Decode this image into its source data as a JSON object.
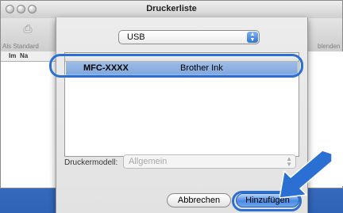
{
  "window": {
    "title": "Druckerliste"
  },
  "toolbar": {
    "left_label": "Als Standard",
    "right_label": "blenden"
  },
  "list_columns": [
    "Im",
    "Na"
  ],
  "sheet": {
    "connection_popup": {
      "selected": "USB"
    },
    "printer_list": {
      "rows": [
        {
          "name": "MFC-XXXX",
          "kind": "Brother Ink",
          "selected": true
        }
      ]
    },
    "model": {
      "label": "Druckermodell:",
      "value": "Allgemein",
      "enabled": false
    },
    "buttons": {
      "cancel": "Abbrechen",
      "add": "Hinzufügen"
    }
  },
  "colors": {
    "highlight": "#2a6fd1",
    "selection": "#9ebde6",
    "default_button": "#4a8ae3"
  },
  "icons": [
    "printer-icon",
    "popup-arrows-icon",
    "callout-arrow-icon"
  ]
}
